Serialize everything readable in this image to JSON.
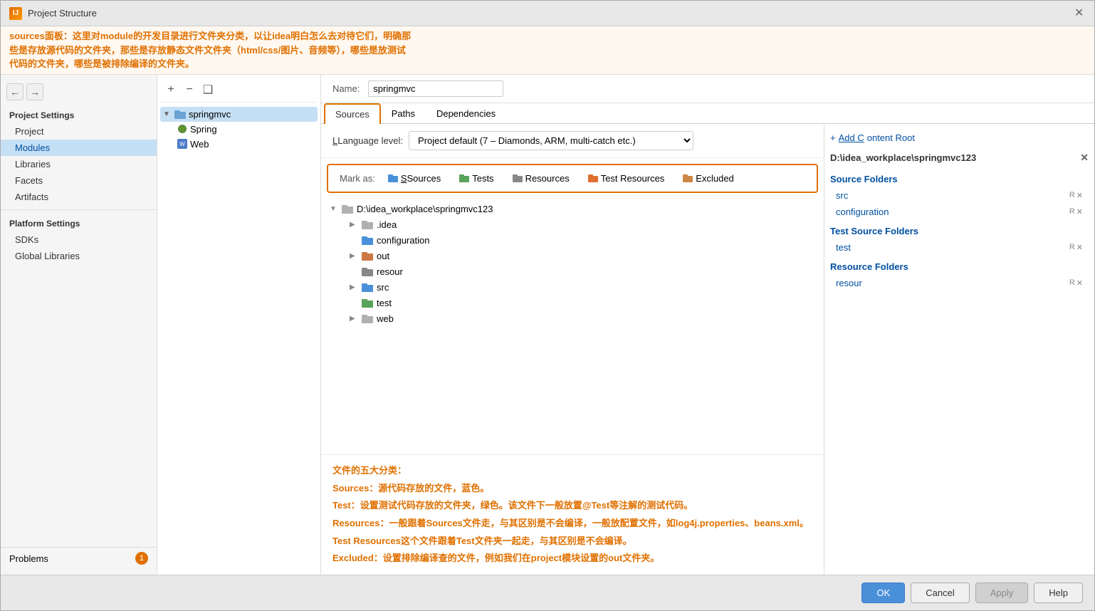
{
  "window": {
    "title": "Project Structure",
    "app_icon_label": "IJ"
  },
  "annotation": {
    "line1": "sources面板：这里对module的开发目录进行文件夹分类，以让idea明白怎么去对待它们，明确那",
    "line2": "些是存放源代码的文件夹，那些是存放静态文件文件夹（html/css/图片、音频等），哪些是放测试",
    "line3": "代码的文件夹，哪些是被排除编译的文件夹。"
  },
  "sidebar": {
    "project_settings_label": "Project Settings",
    "items": [
      {
        "id": "project",
        "label": "Project"
      },
      {
        "id": "modules",
        "label": "Modules",
        "active": true
      },
      {
        "id": "libraries",
        "label": "Libraries"
      },
      {
        "id": "facets",
        "label": "Facets"
      },
      {
        "id": "artifacts",
        "label": "Artifacts"
      }
    ],
    "platform_settings_label": "Platform Settings",
    "platform_items": [
      {
        "id": "sdks",
        "label": "SDKs"
      },
      {
        "id": "global-libraries",
        "label": "Global Libraries"
      }
    ],
    "problems_label": "Problems",
    "problems_count": "1"
  },
  "tree": {
    "root": {
      "name": "springmvc",
      "children": [
        {
          "name": "Spring",
          "icon": "spring"
        },
        {
          "name": "Web",
          "icon": "web"
        }
      ]
    }
  },
  "toolbar": {
    "add_icon": "+",
    "remove_icon": "−",
    "copy_icon": "❑"
  },
  "module": {
    "name_label": "Name:",
    "name_value": "springmvc"
  },
  "tabs": {
    "sources_label": "Sources",
    "paths_label": "Paths",
    "dependencies_label": "Dependencies"
  },
  "lang_level": {
    "label": "Language level:",
    "value": "Project default (7 – Diamonds, ARM, multi-catch etc.)"
  },
  "mark_as": {
    "label": "Mark as:",
    "sources_label": "Sources",
    "tests_label": "Tests",
    "resources_label": "Resources",
    "test_resources_label": "Test Resources",
    "excluded_label": "Excluded"
  },
  "file_tree": {
    "root": "D:\\idea_workplace\\springmvc123",
    "items": [
      {
        "name": ".idea",
        "has_arrow": true,
        "indent": 1
      },
      {
        "name": "configuration",
        "has_arrow": false,
        "indent": 1
      },
      {
        "name": "out",
        "has_arrow": true,
        "indent": 1
      },
      {
        "name": "resour",
        "has_arrow": false,
        "indent": 1
      },
      {
        "name": "src",
        "has_arrow": true,
        "indent": 1
      },
      {
        "name": "test",
        "has_arrow": false,
        "indent": 1
      },
      {
        "name": "web",
        "has_arrow": true,
        "indent": 1
      }
    ]
  },
  "annotations": {
    "category_title": "文件的五大分类：",
    "sources_desc": "Sources：源代码存放的文件，蓝色。",
    "test_desc": "Test：设置测试代码存放的文件夹，绿色。该文件下一般放置@Test等注解的测试代码。",
    "resources_desc": "Resources：一般跟着Sources文件走，与其区别是不会编译，一般放配置文件，如log4j.properties、beans.xml。",
    "test_resources_desc": "Test Resources这个文件跟着Test文件夹一起走，与其区别是不会编译。",
    "excluded_desc": "Excluded：设置排除编译查的文件，例如我们在project模块设置的out文件夹。"
  },
  "right_panel": {
    "add_content_root_label": "+ Add Content Root",
    "root_path": "D:\\idea_workplace\\springmvc123",
    "source_folders_title": "Source Folders",
    "source_folders": [
      {
        "name": "src"
      },
      {
        "name": "configuration"
      }
    ],
    "test_source_title": "Test Source Folders",
    "test_source_folders": [
      {
        "name": "test"
      }
    ],
    "resource_folders_title": "Resource Folders",
    "resource_folders": [
      {
        "name": "resour"
      }
    ]
  },
  "bottom": {
    "ok_label": "OK",
    "cancel_label": "Cancel",
    "apply_label": "Apply",
    "help_label": "Help"
  }
}
